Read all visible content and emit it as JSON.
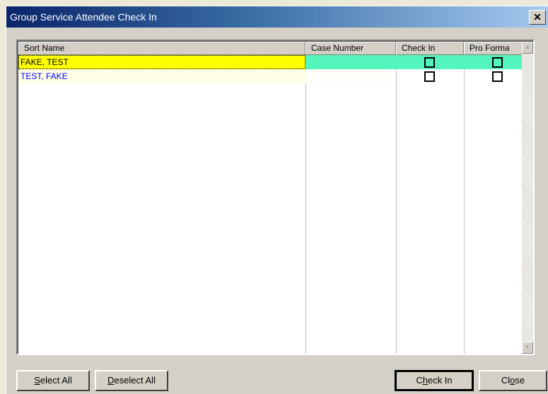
{
  "window": {
    "title": "Group Service Attendee Check In",
    "close_glyph": "✕"
  },
  "grid": {
    "columns": [
      "Sort Name",
      "Case Number",
      "Check In",
      "Pro Forma"
    ],
    "rows": [
      {
        "name": "FAKE, TEST",
        "case_number": "",
        "check_in": false,
        "pro_forma": false,
        "selected": true
      },
      {
        "name": "TEST, FAKE",
        "case_number": "",
        "check_in": false,
        "pro_forma": false,
        "selected": false
      }
    ]
  },
  "buttons": {
    "select_all": {
      "mnemonic": "S",
      "rest": "elect All"
    },
    "deselect_all": {
      "mnemonic": "D",
      "rest": "eselect All"
    },
    "check_in": {
      "pre": "C",
      "mnemonic": "h",
      "rest": "eck In"
    },
    "close": {
      "pre": "Cl",
      "mnemonic": "o",
      "rest": "se"
    }
  },
  "colors": {
    "selected_name_bg": "#ffff00",
    "selected_row_bg": "#53f5bd",
    "name_text": "#0000ff"
  },
  "icons": {
    "scroll_up": "triangle-up",
    "scroll_down": "triangle-down"
  }
}
